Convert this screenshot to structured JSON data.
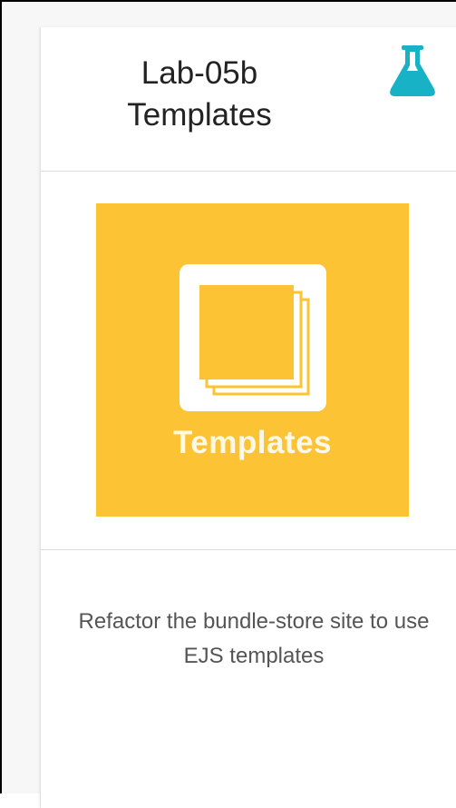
{
  "card": {
    "title_line1": "Lab-05b",
    "title_line2": "Templates",
    "icon": "flask-icon",
    "tile": {
      "label": "Templates",
      "icon": "templates-icon",
      "background": "#fcc434"
    },
    "description": "Refactor the bundle-store site to use EJS templates"
  },
  "colors": {
    "flask": "#17b2c6",
    "tile": "#fcc434"
  }
}
